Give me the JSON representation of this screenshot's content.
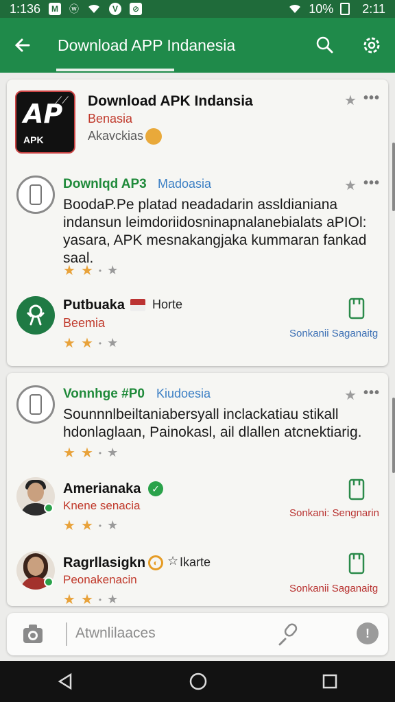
{
  "status_bar": {
    "time_left": "1:136",
    "battery": "10%",
    "time_right": "2:11"
  },
  "app_bar": {
    "title": "Download APP Indanesia"
  },
  "featured": {
    "title": "Download APK Indansia",
    "subtitle": "Benasia",
    "meta": "Akavckias",
    "icon_text": "AP",
    "icon_sub": "APK"
  },
  "items": [
    {
      "title": "Downlqd AP3",
      "tag": "Madoasia",
      "description": "BoodaP.Pe platad neadadarin assldianiana indansun leimdoriidosninapnalanebialats aPIOl: yasara, APK mesnakangjaka kummaran fankad saal."
    },
    {
      "title": "Putbuaka",
      "tag": "Horte",
      "subtitle": "Beemia",
      "action": "Sonkanii Saganaitg"
    }
  ],
  "card2": {
    "post": {
      "title": "Vonnhge #P0",
      "tag": "Kiudoesia",
      "description": "Sounnnlbeiltaniabersyall inclackatiau stikall hdonlaglaan, Painokasl, ail dlallen atcnektiarig."
    },
    "users": [
      {
        "name": "Amerianaka",
        "subtitle": "Knene senacia",
        "action": "Sonkani: Sengnarin"
      },
      {
        "name": "Ragrllasigkn",
        "tag": "Ikarte",
        "subtitle": "Peonakenacin",
        "action": "Sonkanii Saganaitg"
      }
    ]
  },
  "bottom_input": {
    "placeholder": "Atwnlilaaces"
  },
  "colors": {
    "primary": "#1f8a4a",
    "status_bar": "#1f6b3a",
    "star": "#e8a23a",
    "accent_red": "#c0392b",
    "accent_blue": "#3b7fc4"
  },
  "icons": [
    "back-arrow-icon",
    "search-icon",
    "settings-icon",
    "star-icon",
    "more-icon",
    "save-icon",
    "camera-icon",
    "mic-icon",
    "info-icon",
    "verified-icon"
  ]
}
